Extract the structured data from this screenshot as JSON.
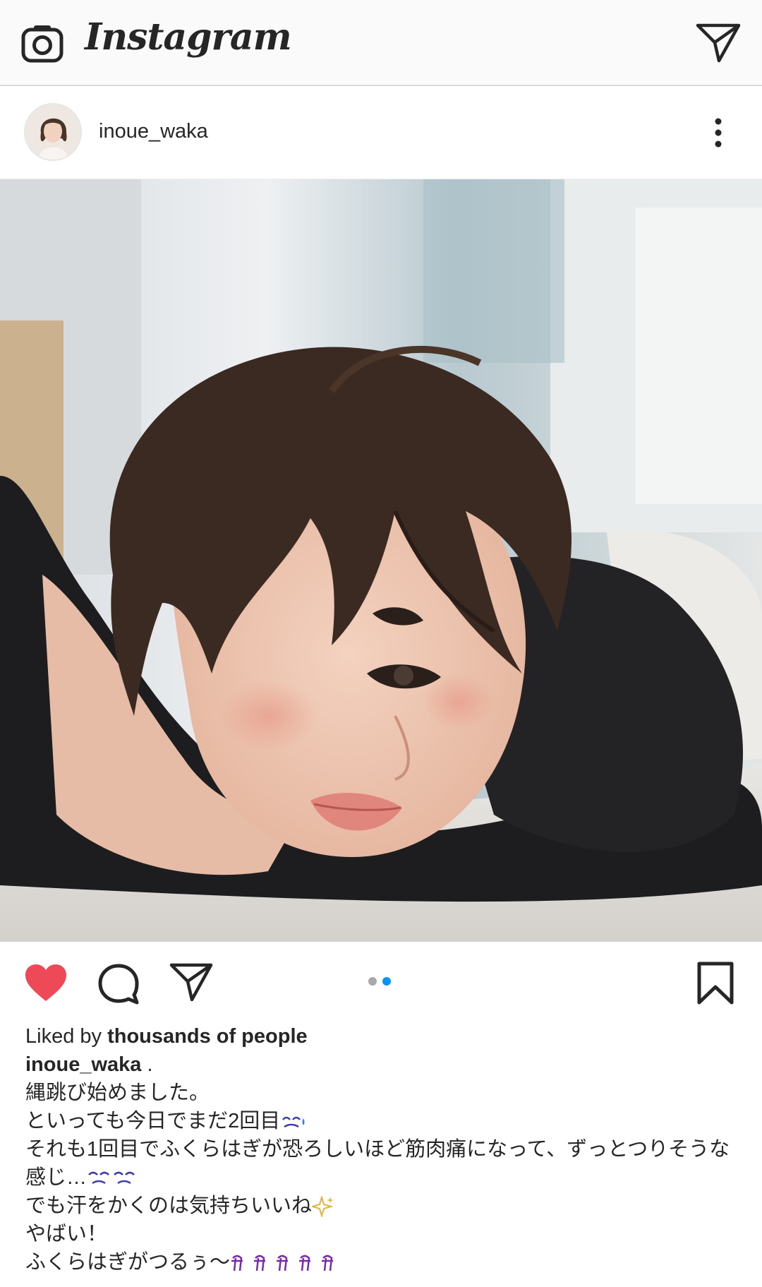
{
  "app": {
    "title": "Instagram"
  },
  "post": {
    "username": "inoue_waka",
    "carousel": {
      "count": 2,
      "active_index": 1
    },
    "liked_by_prefix": "Liked by ",
    "liked_by": "thousands of people",
    "caption_user": "inoue_waka",
    "caption_user_suffix": " .",
    "caption_lines": [
      "縄跳び始めました。",
      "といっても今日でまだ2回目",
      "それも1回目でふくらはぎが恐ろしいほど筋肉痛になって、ずっとつりそうな感じ…",
      "でも汗をかくのは気持ちいいね",
      "やばい！",
      "ふくらはぎがつるぅ〜"
    ]
  },
  "icons": {
    "camera": "camera-icon",
    "direct": "paper-plane-icon",
    "more": "more-vertical-icon",
    "like": "heart-icon",
    "comment": "comment-icon",
    "share": "paper-plane-icon",
    "save": "bookmark-icon"
  },
  "colors": {
    "like": "#ed4956",
    "active_dot": "#0095f6",
    "inactive_dot": "#a8a8a8",
    "topbar_bg": "#fafafa"
  }
}
